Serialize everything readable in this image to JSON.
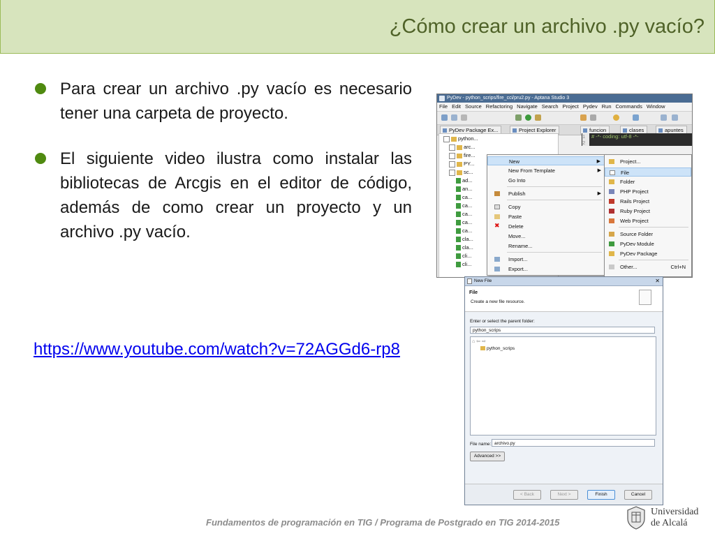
{
  "slide": {
    "title": "¿Cómo crear un archivo .py vacío?",
    "bullets": [
      "Para crear un archivo .py vacío es necesario tener una carpeta de proyecto.",
      "El siguiente video ilustra como instalar las bibliotecas de Arcgis en el editor de código, además de como crear un proyecto y un archivo .py vacío."
    ],
    "link": "https://www.youtube.com/watch?v=72AGGd6-rp8",
    "footer": "Fundamentos de programación en TIG / Programa de Postgrado en TIG 2014-2015",
    "logo_line1": "Universidad",
    "logo_line2": "de Alcalá",
    "bullet_color": "#4f8a10",
    "title_bg": "#d7e4bd"
  },
  "ide": {
    "window_title": "PyDev - python_scrips/fire_cci/pru2.py - Aptana Studio 3",
    "menu": [
      "File",
      "Edit",
      "Source",
      "Refactoring",
      "Navigate",
      "Search",
      "Project",
      "Pydev",
      "Run",
      "Commands",
      "Window"
    ],
    "tabs": [
      "PyDev Package Ex...",
      "Project Explorer",
      "funcion",
      "clases",
      "apuntes"
    ],
    "tree": [
      "python...",
      "arc...",
      "fire...",
      "PY...",
      "sc...",
      "ad...",
      "an...",
      "ca...",
      "ca...",
      "ca...",
      "ca...",
      "ca...",
      "cla...",
      "cla...",
      "cli...",
      "cli..."
    ],
    "editor_lines": [
      "1",
      "2"
    ],
    "editor_code": "# -*- coding: utf-8 -*-",
    "context_menu": [
      "New",
      "New From Template",
      "Go Into",
      "Publish",
      "Copy",
      "Paste",
      "Delete",
      "Move...",
      "Rename...",
      "Import...",
      "Export..."
    ],
    "submenu": [
      "Project...",
      "File",
      "Folder",
      "PHP Project",
      "Rails Project",
      "Ruby Project",
      "Web Project",
      "Source Folder",
      "PyDev Module",
      "PyDev Package",
      "Other..."
    ],
    "submenu_shortcut": "Ctrl+N"
  },
  "dialog": {
    "title": "New File",
    "heading": "File",
    "subheading": "Create a new file resource.",
    "parent_label": "Enter or select the parent folder:",
    "parent_value": "python_scrips",
    "tree_node": "python_scrips",
    "file_name_label": "File name:",
    "file_name_value": "archivo.py",
    "advanced": "Advanced >>",
    "buttons": [
      "< Back",
      "Next >",
      "Finish",
      "Cancel"
    ]
  }
}
